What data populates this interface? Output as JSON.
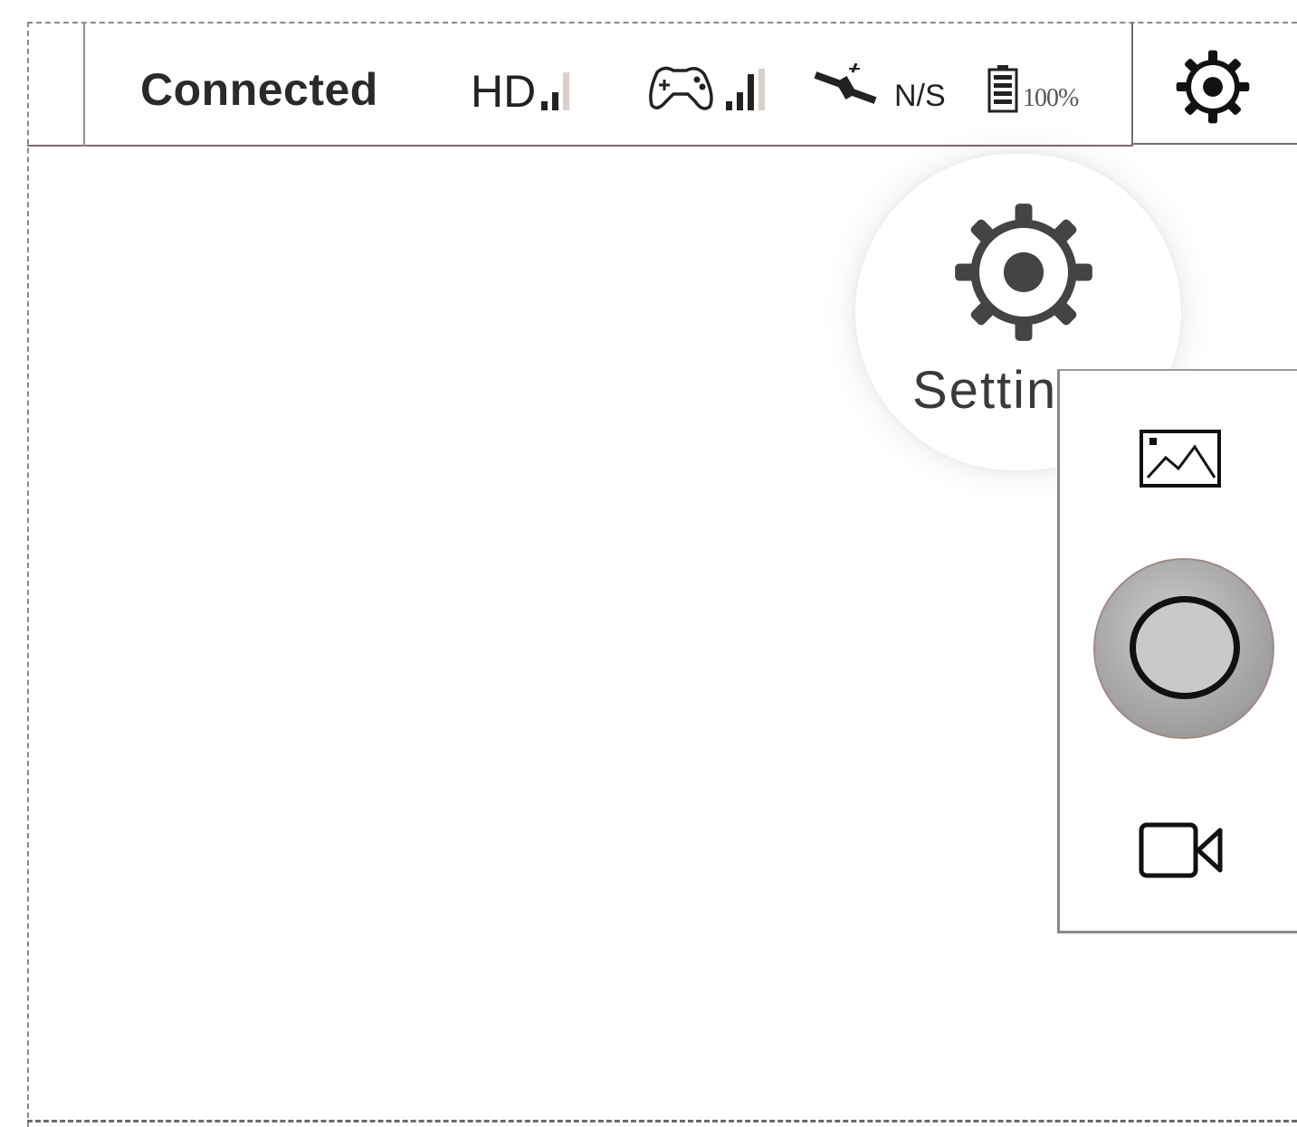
{
  "status_bar": {
    "connection_status": "Connected",
    "hd_label": "HD",
    "hd_signal_level": 2,
    "rc_signal_level": 2,
    "gps_label": "N/S",
    "battery_label": "100%",
    "battery_level": 1.0
  },
  "settings_popup": {
    "label": "Settings"
  },
  "icons": {
    "settings_top": "gear-icon",
    "settings_popup": "gear-icon",
    "hd": "hd-signal-icon",
    "rc": "gamepad-icon",
    "gps": "satellite-icon",
    "battery": "battery-icon",
    "gallery": "gallery-icon",
    "shutter": "shutter-button",
    "video": "video-camera-icon"
  }
}
